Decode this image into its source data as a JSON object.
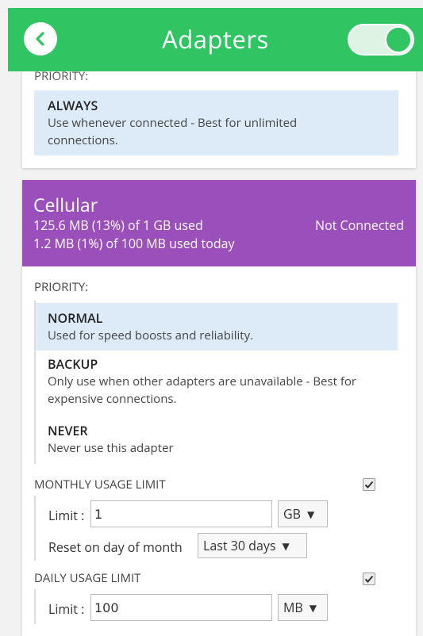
{
  "header": {
    "title": "Adapters",
    "toggle_on": true,
    "color": "#30c463"
  },
  "wifi_card": {
    "priority_label": "PRIORITY:",
    "selected_option": {
      "title": "ALWAYS",
      "desc_line1": "Use whenever connected - Best for unlimited",
      "desc_line2": "connections."
    }
  },
  "cellular_card": {
    "name": "Cellular",
    "usage_line1": "125.6 MB (13%) of 1 GB used",
    "usage_line2": "1.2 MB (1%) of 100 MB used today",
    "status": "Not Connected",
    "header_color": "#9b4fbb",
    "priority_label": "PRIORITY:",
    "options": [
      {
        "title": "NORMAL",
        "desc": "Used for speed boosts and reliability.",
        "selected": true
      },
      {
        "title": "BACKUP",
        "desc_line1": "Only use when other adapters are unavailable - Best for",
        "desc_line2": "expensive connections.",
        "selected": false
      },
      {
        "title": "NEVER",
        "desc": "Never use this adapter",
        "selected": false
      }
    ],
    "monthly": {
      "label": "MONTHLY USAGE LIMIT",
      "checked": true,
      "limit_label": "Limit :",
      "limit_value": "1",
      "unit": "GB",
      "reset_label": "Reset on day of month",
      "reset_value": "Last 30 days"
    },
    "daily": {
      "label": "DAILY USAGE LIMIT",
      "checked": true,
      "limit_label": "Limit :",
      "limit_value": "100",
      "unit": "MB"
    }
  }
}
